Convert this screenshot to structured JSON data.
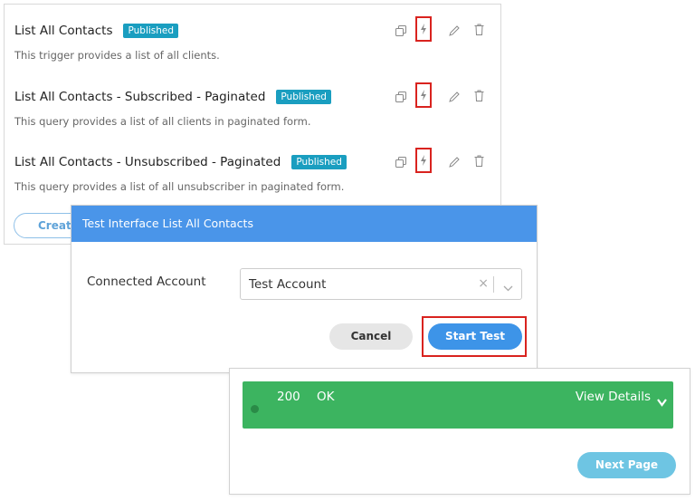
{
  "interfaces": [
    {
      "title": "List All Contacts",
      "status": "Published",
      "description": "This trigger provides a list of all clients."
    },
    {
      "title": "List All Contacts - Subscribed - Paginated",
      "status": "Published",
      "description": "This query provides a list of all clients in paginated form."
    },
    {
      "title": "List All Contacts - Unsubscribed - Paginated",
      "status": "Published",
      "description": "This query provides a list of all unsubscriber in paginated form."
    }
  ],
  "icons": {
    "copy": "copy-icon",
    "test": "lightning-icon",
    "edit": "pencil-icon",
    "delete": "trash-icon"
  },
  "create_button_label": "Creat",
  "modal": {
    "title": "Test Interface List All Contacts",
    "account_label": "Connected Account",
    "account_value": "Test Account",
    "clear_symbol": "×",
    "cancel_label": "Cancel",
    "start_label": "Start Test"
  },
  "result": {
    "status_code": "200",
    "status_text": "OK",
    "details_label": "View Details",
    "next_page_label": "Next Page"
  },
  "colors": {
    "header_blue": "#4a95e9",
    "badge": "#1a9ec0",
    "success_green": "#3cb460",
    "highlight_red": "#d9231f"
  }
}
